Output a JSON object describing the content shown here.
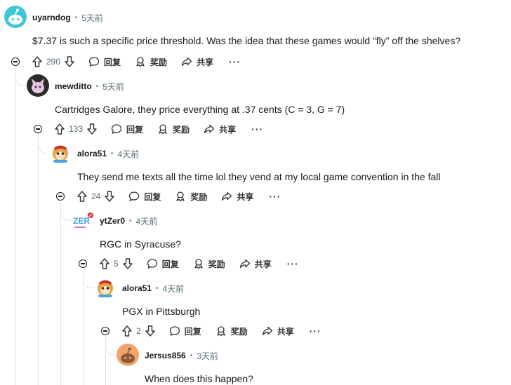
{
  "comments": [
    {
      "username": "uyarndog",
      "time": "5天前",
      "text": "$7.37 is such a specific price threshold. Was the idea that these games would “fly” off the shelves?",
      "votes": "290",
      "avatar_color": "#3ec8d6"
    },
    {
      "username": "mewditto",
      "time": "5天前",
      "text": "Cartridges Galore, they price everything at .37 cents (C = 3, G = 7)",
      "votes": "133",
      "avatar_color": "#2b2b2b"
    },
    {
      "username": "alora51",
      "time": "4天前",
      "text": "They send me texts all the time lol they vend at my local game convention in the fall",
      "votes": "24",
      "avatar_color": "#e9a144"
    },
    {
      "username": "ytZer0",
      "time": "4天前",
      "text": "RGC in Syracuse?",
      "votes": "5",
      "avatar_color": "#ffffff"
    },
    {
      "username": "alora51",
      "time": "4天前",
      "text": "PGX in Pittsburgh",
      "votes": "2",
      "avatar_color": "#e9a144"
    },
    {
      "username": "Jersus856",
      "time": "3天前",
      "text": "When does this happen?",
      "votes": "",
      "avatar_color": "#f2a56b"
    }
  ],
  "actions": {
    "reply": "回复",
    "award": "奖励",
    "share": "共享",
    "more": "···"
  },
  "dot": "•",
  "ytzero_logo": "ZER"
}
